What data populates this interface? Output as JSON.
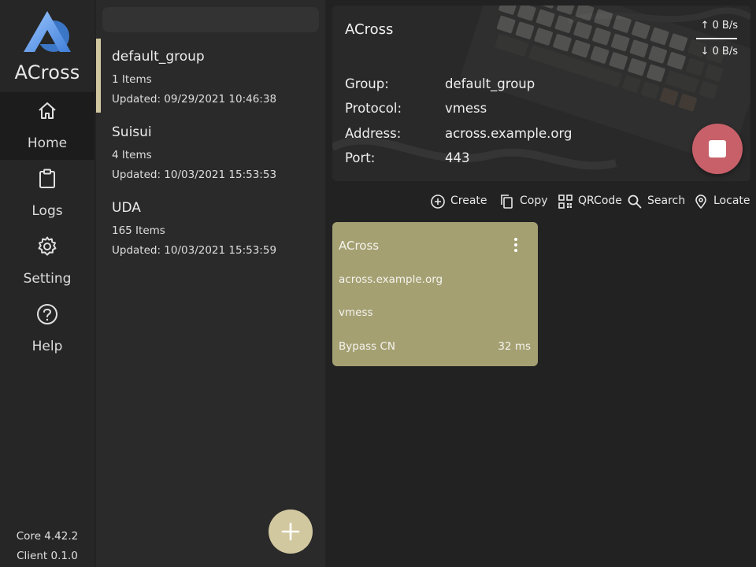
{
  "sidebar": {
    "app_name": "ACross",
    "nav": [
      {
        "label": "Home",
        "icon": "home-icon"
      },
      {
        "label": "Logs",
        "icon": "clipboard-icon"
      },
      {
        "label": "Setting",
        "icon": "gear-icon"
      },
      {
        "label": "Help",
        "icon": "help-icon"
      }
    ],
    "core_version": "Core 4.42.2",
    "client_version": "Client 0.1.0",
    "logo_color": "#5b9cf0"
  },
  "groups": {
    "items": [
      {
        "name": "default_group",
        "count": "1 Items",
        "updated": "Updated: 09/29/2021 10:46:38"
      },
      {
        "name": "Suisui",
        "count": "4 Items",
        "updated": "Updated: 10/03/2021 15:53:53"
      },
      {
        "name": "UDA",
        "count": "165 Items",
        "updated": "Updated: 10/03/2021 15:53:59"
      }
    ],
    "accent_color": "#d2c8a0"
  },
  "hero": {
    "title": "ACross",
    "upload": "0 B/s",
    "download": "0 B/s",
    "info": [
      {
        "key": "Group:",
        "value": "default_group"
      },
      {
        "key": "Protocol:",
        "value": "vmess"
      },
      {
        "key": "Address:",
        "value": "across.example.org"
      },
      {
        "key": "Port:",
        "value": "443"
      }
    ],
    "stop_color": "#c8606a"
  },
  "toolbar": {
    "create": "Create",
    "copy": "Copy",
    "qrcode": "QRCode",
    "search": "Search",
    "locate": "Locate"
  },
  "node": {
    "name": "ACross",
    "address": "across.example.org",
    "protocol": "vmess",
    "route": "Bypass CN",
    "latency": "32 ms",
    "color": "#a5a072"
  }
}
